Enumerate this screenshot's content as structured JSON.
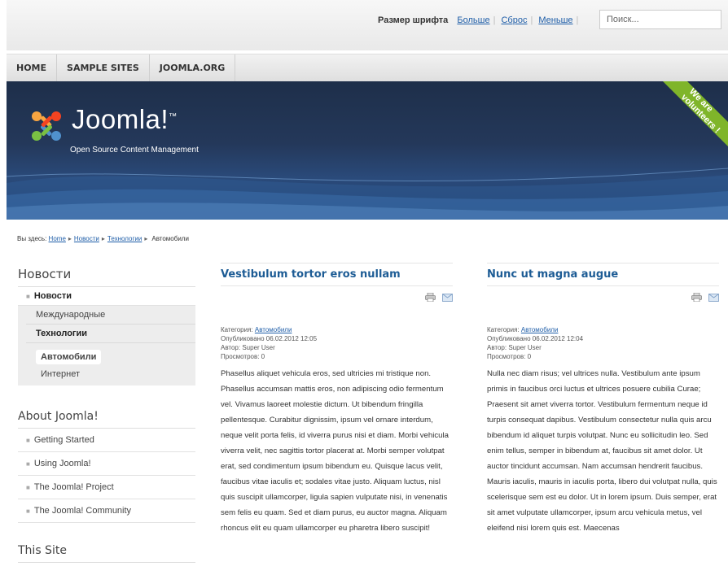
{
  "topbar": {
    "font_size_label": "Размер шрифта",
    "bigger": "Больше",
    "reset": "Сброс",
    "smaller": "Меньше",
    "search_placeholder": "Поиск..."
  },
  "nav": {
    "items": [
      "HOME",
      "SAMPLE SITES",
      "JOOMLA.ORG"
    ]
  },
  "banner": {
    "logo_text": "Joomla!",
    "trademark": "™",
    "tagline": "Open Source Content Management",
    "ribbon_line1": "We are",
    "ribbon_line2": "volunteers !"
  },
  "breadcrumb": {
    "prefix": "Вы здесь:",
    "home": "Home",
    "news": "Новости",
    "tech": "Технологии",
    "current": "Автомобили"
  },
  "sidebar": {
    "news_title": "Новости",
    "news_items": {
      "root": "Новости",
      "international": "Международные",
      "technology": "Технологии",
      "cars": "Автомобили",
      "internet": "Интернет"
    },
    "about_title": "About Joomla!",
    "about_items": [
      "Getting Started",
      "Using Joomla!",
      "The Joomla! Project",
      "The Joomla! Community"
    ],
    "site_title": "This Site"
  },
  "articles": [
    {
      "title": "Vestibulum tortor eros nullam",
      "category_label": "Категория:",
      "category": "Автомобили",
      "published": "Опубликовано 06.02.2012 12:05",
      "author": "Автор: Super User",
      "views": "Просмотров: 0",
      "text": "Phasellus aliquet vehicula eros, sed ultricies mi tristique non. Phasellus accumsan mattis eros, non adipiscing odio fermentum vel. Vivamus laoreet molestie dictum. Ut bibendum fringilla pellentesque. Curabitur dignissim, ipsum vel ornare interdum, neque velit porta felis, id viverra purus nisi et diam. Morbi vehicula viverra velit, nec sagittis tortor placerat at. Morbi semper volutpat erat, sed condimentum ipsum bibendum eu. Quisque lacus velit, faucibus vitae iaculis et; sodales vitae justo. Aliquam luctus, nisl quis suscipit ullamcorper, ligula sapien vulputate nisi, in venenatis sem felis eu quam. Sed et diam purus, eu auctor magna. Aliquam rhoncus elit eu quam ullamcorper eu pharetra libero suscipit!"
    },
    {
      "title": "Nunc ut magna augue",
      "category_label": "Категория:",
      "category": "Автомобили",
      "published": "Опубликовано 06.02.2012 12:04",
      "author": "Автор: Super User",
      "views": "Просмотров: 0",
      "text": "Nulla nec diam risus; vel ultrices nulla. Vestibulum ante ipsum primis in faucibus orci luctus et ultrices posuere cubilia Curae; Praesent sit amet viverra tortor. Vestibulum fermentum neque id turpis consequat dapibus. Vestibulum consectetur nulla quis arcu bibendum id aliquet turpis volutpat. Nunc eu sollicitudin leo. Sed enim tellus, semper in bibendum at, faucibus sit amet dolor. Ut auctor tincidunt accumsan. Nam accumsan hendrerit faucibus. Mauris iaculis, mauris in iaculis porta, libero dui volutpat nulla, quis scelerisque sem est eu dolor. Ut in lorem ipsum. Duis semper, erat sit amet vulputate ullamcorper, ipsum arcu vehicula metus, vel eleifend nisi lorem quis est. Maecenas"
    }
  ],
  "colors": {
    "link": "#1f5ea8",
    "title": "#1d5c95",
    "banner": "#24385a",
    "ribbon": "#7fb52a"
  }
}
